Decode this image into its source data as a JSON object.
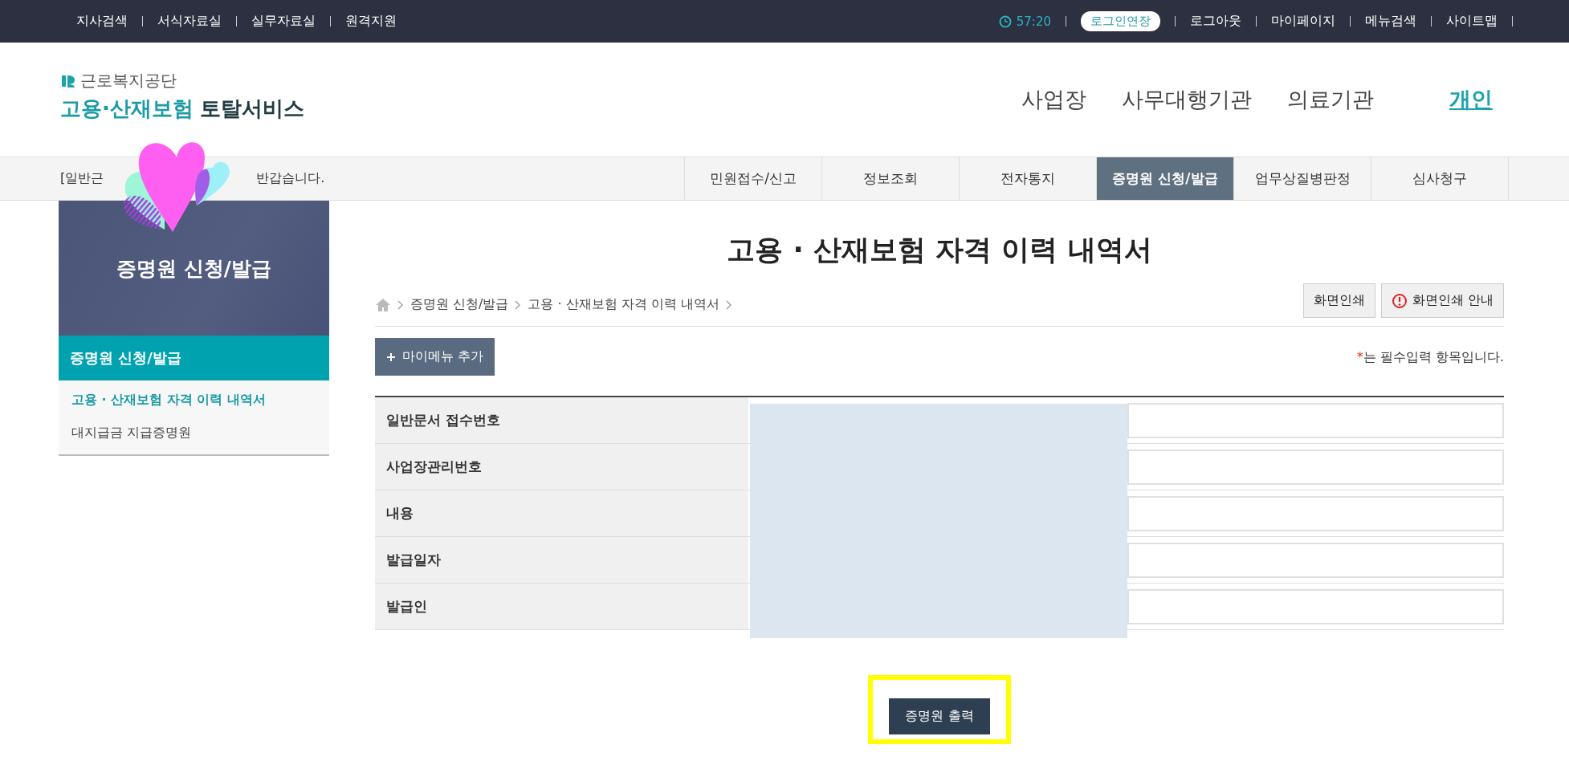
{
  "top_bar": {
    "left_links": [
      "지사검색",
      "서식자료실",
      "실무자료실",
      "원격지원"
    ],
    "timer": "57:20",
    "extend_button": "로그인연장",
    "right_links": [
      "로그아웃",
      "마이페이지",
      "메뉴검색",
      "사이트맵"
    ]
  },
  "logo": {
    "org": "근로복지공단",
    "service_highlight": "고용·산재보험",
    "service_rest": "토탈서비스"
  },
  "audience_nav": [
    {
      "label": "사업장",
      "selected": false
    },
    {
      "label": "사무대행기관",
      "selected": false
    },
    {
      "label": "의료기관",
      "selected": false
    },
    {
      "label": "개인",
      "selected": true
    }
  ],
  "greeting": {
    "start": "[일반근",
    "end": "반갑습니다."
  },
  "main_nav": [
    {
      "label": "민원접수/신고",
      "selected": false
    },
    {
      "label": "정보조회",
      "selected": false
    },
    {
      "label": "전자통지",
      "selected": false
    },
    {
      "label": "증명원 신청/발급",
      "selected": true
    },
    {
      "label": "업무상질병판정",
      "selected": false
    },
    {
      "label": "심사청구",
      "selected": false
    }
  ],
  "sidebar": {
    "title": "증명원 신청/발급",
    "section": "증명원 신청/발급",
    "items": [
      {
        "label": "고용 · 산재보험 자격 이력 내역서",
        "selected": true
      },
      {
        "label": "대지급금 지급증명원",
        "selected": false
      }
    ]
  },
  "page_title": "고용 · 산재보험 자격 이력 내역서",
  "breadcrumb": [
    "증명원 신청/발급",
    "고용 · 산재보험 자격 이력 내역서"
  ],
  "print_buttons": [
    "화면인쇄",
    "화면인쇄 안내"
  ],
  "mymenu_button": "마이메뉴 추가",
  "required_note": {
    "mark": "*",
    "text": "는 필수입력 항목입니다."
  },
  "form_rows": [
    "일반문서 접수번호",
    "사업장관리번호",
    "내용",
    "발급일자",
    "발급인"
  ],
  "submit_button": "증명원 출력"
}
